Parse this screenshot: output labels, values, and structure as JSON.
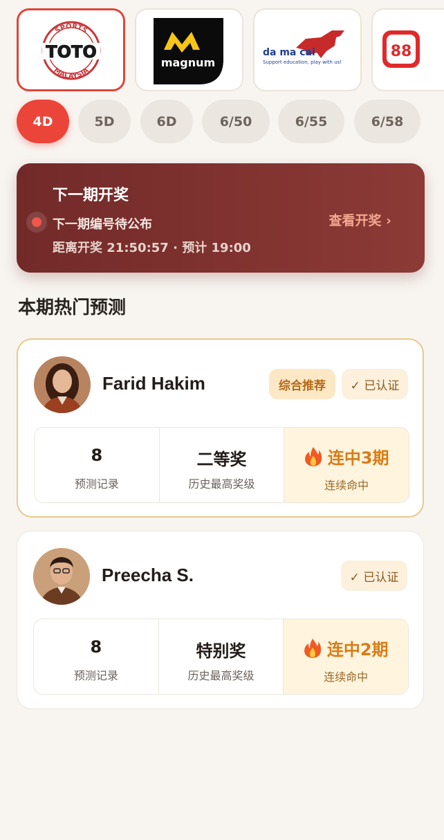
{
  "operators": [
    {
      "name": "toto-logo",
      "text_top": "SPORTS",
      "text_main": "TOTO",
      "text_bottom": "MALAYSIA"
    },
    {
      "name": "magnum-logo",
      "text_main": "magnum"
    },
    {
      "name": "damacai-logo",
      "text_main": "da ma cai",
      "tagline": "Support education, play with us!"
    },
    {
      "name": "88-logo",
      "text_main": "88"
    }
  ],
  "game_types": [
    "4D",
    "5D",
    "6D",
    "6/50",
    "6/55",
    "6/58"
  ],
  "active_game": "4D",
  "next_draw": {
    "title": "下一期开奖",
    "subtitle": "下一期编号待公布",
    "countdown_label": "距离开奖",
    "countdown": "21:50:57",
    "separator": "·",
    "scheduled_label": "预计",
    "scheduled_time": "19:00",
    "link_label": "查看开奖 ›"
  },
  "section_title": "本期热门预测",
  "predictors": [
    {
      "name": "Farid Hakim",
      "badges": [
        "综合推荐",
        "✓ 已认证"
      ],
      "stats": {
        "records_value": "8",
        "records_label": "预测记录",
        "best_value": "二等奖",
        "best_label": "历史最高奖级",
        "streak_value": "连中3期",
        "streak_label": "连续命中"
      }
    },
    {
      "name": "Preecha S.",
      "badges": [
        "✓ 已认证"
      ],
      "stats": {
        "records_value": "8",
        "records_label": "预测记录",
        "best_value": "特别奖",
        "best_label": "历史最高奖级",
        "streak_value": "连中2期",
        "streak_label": "连续命中"
      }
    }
  ],
  "colors": {
    "accent": "#eb4439",
    "banner": "#7a2f2d",
    "streak": "#d97c16",
    "featured_border": "#e8c98a"
  }
}
